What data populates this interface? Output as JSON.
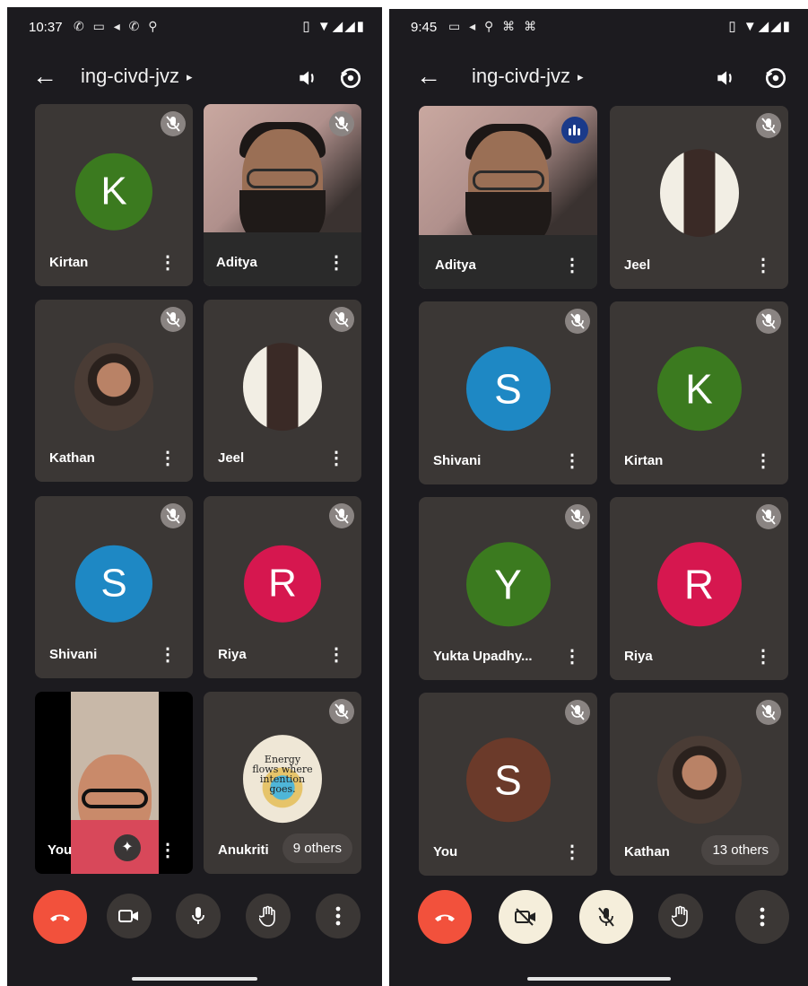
{
  "left": {
    "status": {
      "time": "10:37",
      "notif_icons": "✆ ▭ ◂ ✆ ⚲",
      "system_icons": "▯ ▼◢◢▮"
    },
    "title": "ing-civd-jvz",
    "tiles": [
      {
        "name": "Kirtan",
        "initial": "K",
        "color": "#3b7a1f"
      },
      {
        "name": "Aditya"
      },
      {
        "name": "Kathan"
      },
      {
        "name": "Jeel"
      },
      {
        "name": "Shivani",
        "initial": "S",
        "color": "#1e88c4"
      },
      {
        "name": "Riya",
        "initial": "R",
        "color": "#d6174f"
      },
      {
        "name": "You"
      },
      {
        "name": "Anukriti",
        "others": "9 others"
      }
    ],
    "quote": "Energy flows where intention goes."
  },
  "right": {
    "status": {
      "time": "9:45",
      "notif_icons": "▭ ◂ ⚲ ⌘ ⌘",
      "system_icons": "▯ ▼◢◢▮"
    },
    "title": "ing-civd-jvz",
    "tiles": [
      {
        "name": "Aditya"
      },
      {
        "name": "Jeel"
      },
      {
        "name": "Shivani",
        "initial": "S",
        "color": "#1e88c4"
      },
      {
        "name": "Kirtan",
        "initial": "K",
        "color": "#3b7a1f"
      },
      {
        "name": "Yukta Upadhy...",
        "initial": "Y",
        "color": "#3b7a1f"
      },
      {
        "name": "Riya",
        "initial": "R",
        "color": "#d6174f"
      },
      {
        "name": "You",
        "initial": "S",
        "color": "#6b3a2a"
      },
      {
        "name": "Kathan",
        "others": "13 others"
      }
    ]
  },
  "icons": {
    "back": "←",
    "caret": "▸",
    "kebab": "⋮",
    "sparkle": "✦"
  }
}
